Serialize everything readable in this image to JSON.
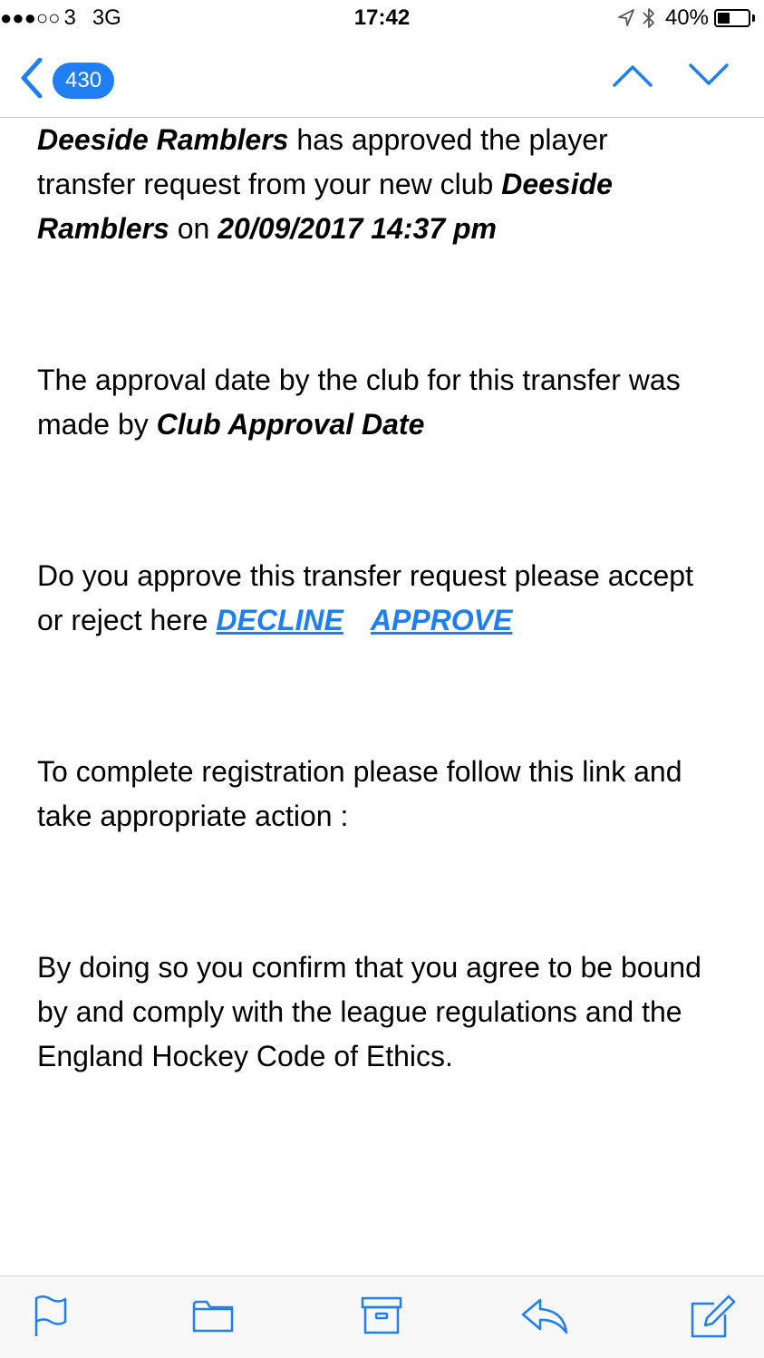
{
  "status_bar": {
    "signal_dots": "●●●○○",
    "carrier": "3",
    "network": "3G",
    "time": "17:42",
    "battery_percent": "40%",
    "battery_level": 0.4,
    "icons": [
      "location-icon",
      "bluetooth-icon",
      "battery-icon"
    ]
  },
  "nav": {
    "back_icon": "chevron-left-icon",
    "message_count": "430",
    "prev_icon": "chevron-up-icon",
    "next_icon": "chevron-down-icon",
    "accent_color": "#1e7ef2"
  },
  "email": {
    "p1": {
      "club1": "Deeside Ramblers",
      "text1": " has approved the player transfer request from your new club ",
      "club2": "Deeside Ramblers",
      "text2": " on ",
      "datetime": "20/09/2017 14:37 pm"
    },
    "p2": {
      "text": "The approval date by the club for this transfer was made by ",
      "emph": "Club Approval Date"
    },
    "p3": {
      "text": "Do you approve this transfer request please accept or reject here ",
      "decline_label": "DECLINE",
      "approve_label": "APPROVE"
    },
    "p4": {
      "text": "To complete registration please follow this link and take appropriate action :"
    },
    "p5": {
      "text": "By doing so you confirm that you  agree to be bound by and comply with the league regulations and the England Hockey Code of Ethics."
    }
  },
  "toolbar": {
    "icons": [
      "flag-icon",
      "folder-icon",
      "archive-icon",
      "reply-icon",
      "compose-icon"
    ]
  }
}
